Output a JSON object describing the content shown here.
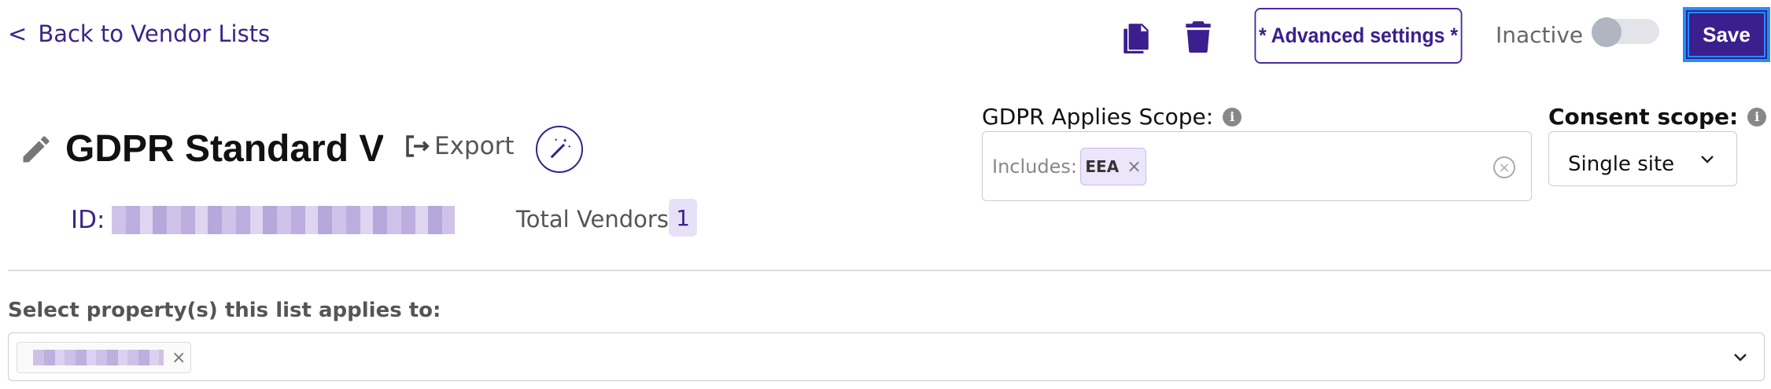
{
  "header": {
    "back_label": "Back to Vendor Lists",
    "back_chevron": "<",
    "icons": {
      "copy": "copy-icon",
      "delete": "trash-icon"
    },
    "advanced_settings_label": "* Advanced settings *",
    "inactive_label": "Inactive",
    "toggle_on": false,
    "save_label": "Save"
  },
  "list": {
    "title": "GDPR Standard Vendor List",
    "export_label": "Export",
    "id_label": "ID:",
    "total_vendors_label": "Total Vendors",
    "total_vendors_count": "1"
  },
  "scope": {
    "label": "GDPR Applies Scope:",
    "includes_label": "Includes:",
    "tags": [
      "EEA"
    ],
    "tag_remove": "×"
  },
  "consent": {
    "label": "Consent scope:",
    "value": "Single site"
  },
  "properties": {
    "label": "Select property(s) this list applies to:",
    "tag_remove": "×"
  },
  "colors": {
    "brand": "#3b1f8e",
    "focus_ring": "#1e90ff",
    "tag_bg": "#ece6fa"
  }
}
